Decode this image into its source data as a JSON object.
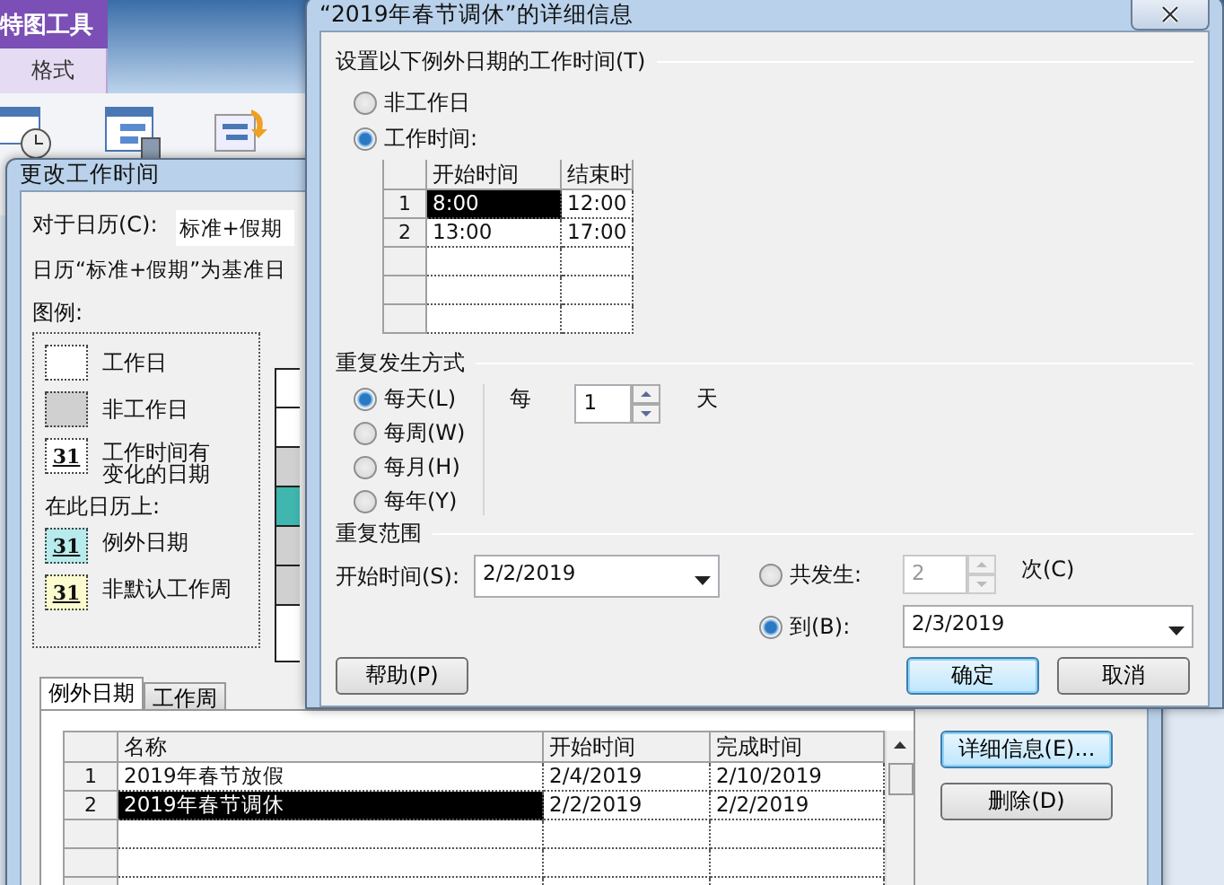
{
  "ribbon": {
    "context_tab": "特图工具",
    "tab": "格式"
  },
  "change_dialog": {
    "title": "更改工作时间",
    "calendar_label": "对于日历(C):",
    "calendar_value": "标准+假期",
    "base_note": "日历“标准+假期”为基准日",
    "legend": {
      "title": "图例:",
      "items": [
        {
          "kind": "swatch",
          "label": "工作日",
          "color": "#ffffff"
        },
        {
          "kind": "swatch",
          "label": "非工作日",
          "color": "#d0d0d0"
        },
        {
          "kind": "day",
          "day": "31",
          "label": "工作时间有变化的日期",
          "color": "#ffffff"
        },
        {
          "kind": "heading",
          "label": "在此日历上:"
        },
        {
          "kind": "day",
          "day": "31",
          "label": "例外日期",
          "color": "#b8ecec"
        },
        {
          "kind": "day",
          "day": "31",
          "label": "非默认工作周",
          "color": "#fbfbcf"
        }
      ]
    },
    "tabs": [
      {
        "label": "例外日期",
        "selected": true
      },
      {
        "label": "工作周",
        "selected": false
      }
    ],
    "table": {
      "columns": [
        "名称",
        "开始时间",
        "完成时间"
      ],
      "rows": [
        {
          "index": "1",
          "name": "2019年春节放假",
          "start": "2/4/2019",
          "finish": "2/10/2019",
          "selected": false
        },
        {
          "index": "2",
          "name": "2019年春节调休",
          "start": "2/2/2019",
          "finish": "2/2/2019",
          "selected": true
        }
      ]
    },
    "buttons": [
      {
        "label": "详细信息(E)...",
        "focused": true
      },
      {
        "label": "删除(D)",
        "focused": false
      }
    ]
  },
  "details_dialog": {
    "title": "“2019年春节调休”的详细信息",
    "working_time": {
      "title": "设置以下例外日期的工作时间(T)",
      "options": [
        {
          "label": "非工作日",
          "selected": false
        },
        {
          "label": "工作时间:",
          "selected": true
        }
      ],
      "columns": [
        "开始时间",
        "结束时"
      ],
      "rows": [
        {
          "index": "1",
          "start": "8:00",
          "end": "12:00",
          "selected": true
        },
        {
          "index": "2",
          "start": "13:00",
          "end": "17:00",
          "selected": false
        }
      ]
    },
    "recurrence": {
      "title": "重复发生方式",
      "options": [
        {
          "label": "每天(L)",
          "selected": true
        },
        {
          "label": "每周(W)",
          "selected": false
        },
        {
          "label": "每月(H)",
          "selected": false
        },
        {
          "label": "每年(Y)",
          "selected": false
        }
      ],
      "every_label": "每",
      "every_value": "1",
      "unit": "天"
    },
    "range": {
      "title": "重复范围",
      "start_label": "开始时间(S):",
      "start_value": "2/2/2019",
      "occurrences": {
        "label": "共发生:",
        "selected": false,
        "value": "2",
        "disabled": true,
        "unit": "次(C)"
      },
      "end_by": {
        "label": "到(B):",
        "selected": true,
        "value": "2/3/2019"
      }
    },
    "buttons": [
      {
        "label": "帮助(P)",
        "default": false
      },
      {
        "label": "确定",
        "default": true
      },
      {
        "label": "取消",
        "default": false
      }
    ]
  }
}
